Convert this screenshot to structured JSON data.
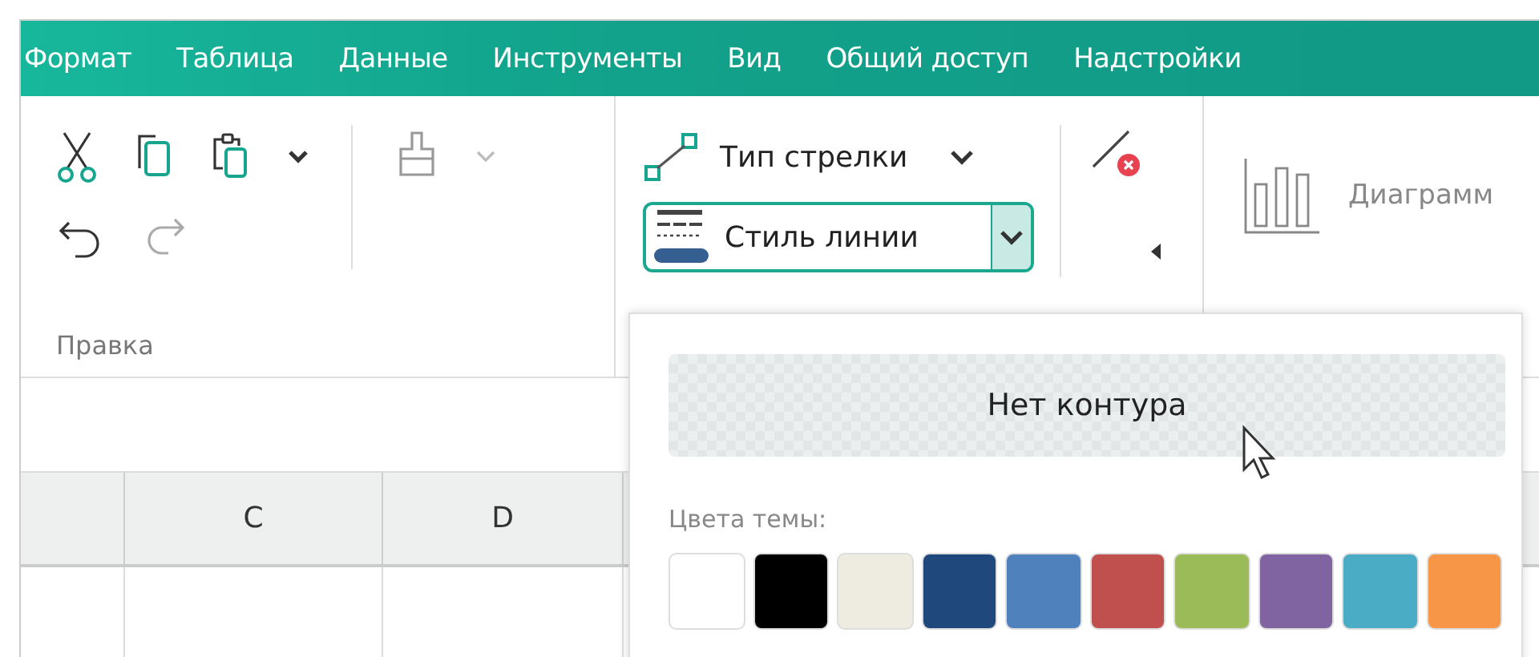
{
  "menu": [
    "Формат",
    "Таблица",
    "Данные",
    "Инструменты",
    "Вид",
    "Общий доступ",
    "Надстройки"
  ],
  "ribbon": {
    "edit_group": {
      "label": "Правка"
    },
    "arrow_type": {
      "label": "Тип стрелки"
    },
    "line_style": {
      "label": "Стиль линии"
    },
    "chart": {
      "label": "Диаграмм"
    }
  },
  "sheet": {
    "columns": [
      "",
      "C",
      "D"
    ]
  },
  "line_menu": {
    "no_outline": "Нет контура",
    "theme_label": "Цвета темы:",
    "colors": [
      {
        "color": "#ffffff"
      },
      {
        "color": "#000000"
      },
      {
        "color": "#eeece1"
      },
      {
        "color": "#1f497d"
      },
      {
        "color": "#4f81bd"
      },
      {
        "color": "#c0504d"
      },
      {
        "color": "#9bbb59"
      },
      {
        "color": "#8064a2"
      },
      {
        "color": "#4bacc6"
      },
      {
        "color": "#f79646"
      }
    ]
  }
}
